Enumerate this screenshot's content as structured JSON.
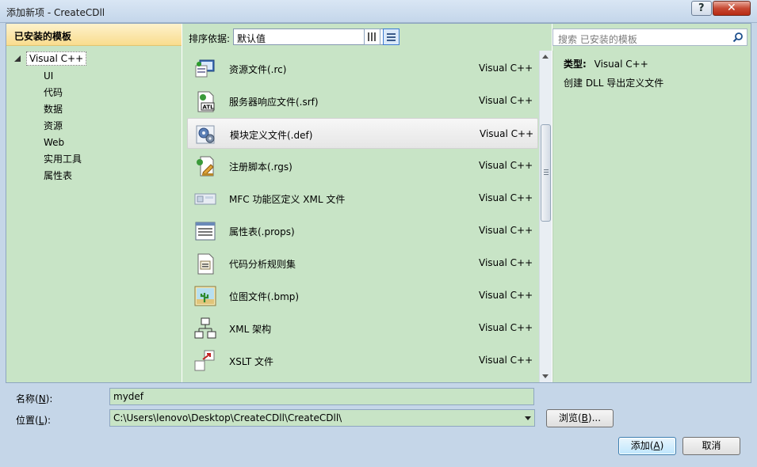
{
  "window": {
    "title": "添加新项 - CreateCDll",
    "help_label": "?",
    "close_label": "✕"
  },
  "left": {
    "header": "已安装的模板",
    "root": "Visual C++",
    "items": [
      "UI",
      "代码",
      "数据",
      "资源",
      "Web",
      "实用工具",
      "属性表"
    ]
  },
  "toolbar": {
    "sort_label": "排序依据:",
    "sort_value": "默认值"
  },
  "search": {
    "placeholder": "搜索 已安装的模板"
  },
  "templates": [
    {
      "name": "资源文件(.rc)",
      "lang": "Visual C++",
      "icon": "resource-file-icon"
    },
    {
      "name": "服务器响应文件(.srf)",
      "lang": "Visual C++",
      "icon": "atl-file-icon"
    },
    {
      "name": "模块定义文件(.def)",
      "lang": "Visual C++",
      "icon": "gears-icon",
      "selected": true
    },
    {
      "name": "注册脚本(.rgs)",
      "lang": "Visual C++",
      "icon": "script-icon"
    },
    {
      "name": "MFC 功能区定义 XML 文件",
      "lang": "Visual C++",
      "icon": "ribbon-icon"
    },
    {
      "name": "属性表(.props)",
      "lang": "Visual C++",
      "icon": "property-sheet-icon"
    },
    {
      "name": "代码分析规则集",
      "lang": "Visual C++",
      "icon": "ruleset-icon"
    },
    {
      "name": "位图文件(.bmp)",
      "lang": "Visual C++",
      "icon": "bitmap-icon"
    },
    {
      "name": "XML 架构",
      "lang": "Visual C++",
      "icon": "xml-schema-icon"
    },
    {
      "name": "XSLT 文件",
      "lang": "Visual C++",
      "icon": "xslt-icon"
    }
  ],
  "details": {
    "type_label": "类型:",
    "type_value": "Visual C++",
    "description": "创建 DLL 导出定义文件"
  },
  "form": {
    "name_label": "名称(",
    "name_key": "N",
    "name_suffix": "):",
    "name_value": "mydef",
    "location_label": "位置(",
    "location_key": "L",
    "location_suffix": "):",
    "location_value": "C:\\Users\\lenovo\\Desktop\\CreateCDll\\CreateCDll\\",
    "browse_label": "浏览(",
    "browse_key": "B",
    "browse_suffix": ")..."
  },
  "buttons": {
    "ok_label": "添加(",
    "ok_key": "A",
    "ok_suffix": ")",
    "cancel_label": "取消"
  }
}
